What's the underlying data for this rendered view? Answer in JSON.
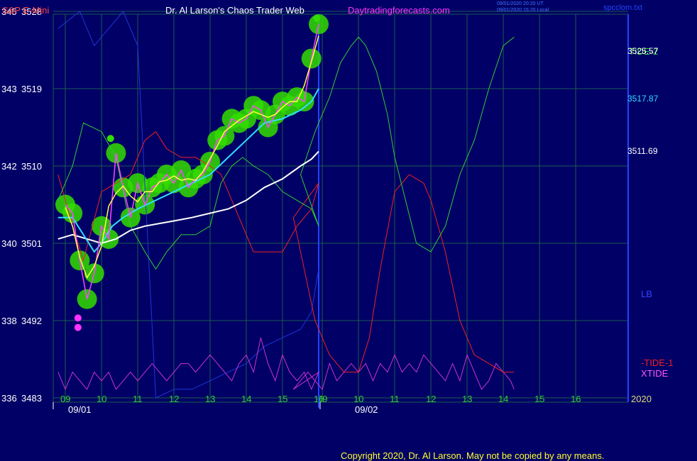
{
  "header": {
    "symbol": "S&P E-Mini",
    "title": "Dr. Al Larson's Chaos Trader Web",
    "site": "Daytradingforecasts.com",
    "stamp_utc": "09/01/2020 20:20 UT",
    "stamp_local": "09/01/2020 15:20 Local",
    "file": "spcclom.txt"
  },
  "right_labels": {
    "tide2": "TIDE-2",
    "tide1": "-TIDE-1",
    "xtide": "XTIDE",
    "lb": "LB",
    "year": "2020",
    "price_1": "3525.57",
    "price_2": "3517.87",
    "price_3": "3511.69"
  },
  "footer": {
    "copyright": "Copyright 2020, Dr. Al Larson. May not be copied by any means."
  },
  "colors": {
    "background": "#000066",
    "grid": "#1e5a4e",
    "price": "#ff44ff",
    "smooth": "#ffff44",
    "ma_cyan": "#33ddff",
    "ma_white": "#ffffff",
    "tide2": "#33cc33",
    "tide1": "#ee2222",
    "xtide": "#cc33cc",
    "lb": "#2233dd",
    "marker": "#33dd00",
    "divider": "#2244ff"
  },
  "chart_data": {
    "type": "line",
    "title": "S&P E-Mini",
    "y_left_outer": [
      "345",
      "343",
      "342",
      "340",
      "338",
      "336"
    ],
    "y_left_inner": [
      "3528",
      "3519",
      "3510",
      "3501",
      "3492",
      "3483"
    ],
    "ylim": [
      3483,
      3528
    ],
    "x_ticks_day1": [
      "09",
      "10",
      "11",
      "12",
      "13",
      "14",
      "15",
      "16"
    ],
    "x_ticks_day2": [
      "09",
      "10",
      "11",
      "12",
      "13",
      "14",
      "15",
      "16"
    ],
    "dates": [
      "09/01",
      "09/02"
    ],
    "series": [
      {
        "name": "S&P E-Mini",
        "x": [
          9.0,
          9.2,
          9.4,
          9.6,
          9.8,
          10.0,
          10.2,
          10.4,
          10.6,
          10.8,
          11.0,
          11.2,
          11.4,
          11.6,
          11.8,
          12.0,
          12.2,
          12.4,
          12.6,
          12.8,
          13.0,
          13.2,
          13.4,
          13.6,
          13.8,
          14.0,
          14.2,
          14.4,
          14.6,
          14.8,
          15.0,
          15.2,
          15.4,
          15.6,
          15.8,
          16.0
        ],
        "y": [
          3505.5,
          3504.5,
          3499,
          3494.5,
          3497.5,
          3503,
          3501.5,
          3511.5,
          3507.5,
          3504,
          3508,
          3505.5,
          3507.5,
          3508,
          3509,
          3508,
          3509.5,
          3507.5,
          3508.5,
          3509,
          3510.5,
          3513,
          3513.5,
          3515.5,
          3515,
          3515.5,
          3517,
          3516.5,
          3514.5,
          3516,
          3517.5,
          3517,
          3518,
          3517.5,
          3522.5,
          3526.5
        ]
      },
      {
        "name": "TIDE-2",
        "x": [
          8.8,
          9.2,
          9.5,
          10.0,
          10.4,
          10.8,
          11.2,
          11.5,
          11.8,
          12.2,
          12.6,
          13.0,
          13.3,
          13.6,
          13.9,
          14.2,
          14.6,
          15.0,
          15.4,
          15.8,
          16.0,
          16.4,
          16.8,
          17.2,
          17.5,
          17.8,
          18.0,
          18.2,
          18.5,
          18.8,
          19.0,
          19.3,
          19.6,
          20.0,
          20.4,
          20.8,
          21.2,
          21.6,
          22.0,
          22.3
        ],
        "y": [
          3506,
          3510,
          3515,
          3514,
          3511,
          3503,
          3500,
          3498,
          3500,
          3502,
          3502,
          3503,
          3508,
          3510,
          3511,
          3510,
          3509,
          3507,
          3506,
          3505,
          3503,
          3509,
          3514,
          3518,
          3522,
          3524,
          3525,
          3524,
          3521,
          3516,
          3511,
          3506,
          3501,
          3500,
          3503,
          3509,
          3513,
          3519,
          3524,
          3525
        ]
      },
      {
        "name": "-TIDE-1",
        "x": [
          8.8,
          9.2,
          9.5,
          10.0,
          10.4,
          10.8,
          11.2,
          11.5,
          11.8,
          12.2,
          12.6,
          13.0,
          13.3,
          13.6,
          13.9,
          14.2,
          14.6,
          15.0,
          15.4,
          15.8,
          16.0,
          16.2,
          16.5,
          16.8,
          17.2,
          17.6,
          18.0,
          18.3,
          18.6,
          19.0,
          19.4,
          19.8,
          20.0,
          20.4,
          20.8,
          21.2,
          21.6,
          22.0,
          22.3
        ],
        "y": [
          3509,
          3503,
          3499,
          3507,
          3508,
          3509,
          3513,
          3514,
          3512,
          3511,
          3511,
          3510,
          3509,
          3506,
          3503,
          3500,
          3500,
          3500,
          3503,
          3505,
          3508,
          3504,
          3498,
          3492,
          3488,
          3486,
          3486,
          3490,
          3498,
          3507,
          3509,
          3508,
          3506,
          3500,
          3492,
          3488,
          3487,
          3486,
          3486
        ]
      },
      {
        "name": "XTIDE",
        "x": [
          8.8,
          9.0,
          9.2,
          9.4,
          9.6,
          9.8,
          10.0,
          10.2,
          10.4,
          10.6,
          10.8,
          11.0,
          11.2,
          11.4,
          11.6,
          11.8,
          12.0,
          12.2,
          12.4,
          12.6,
          12.8,
          13.0,
          13.2,
          13.4,
          13.6,
          13.8,
          14.0,
          14.2,
          14.4,
          14.6,
          14.8,
          15.0,
          15.2,
          15.4,
          15.6,
          15.8,
          16.0,
          16.2,
          16.4,
          16.6,
          16.8,
          17.0,
          17.2,
          17.4,
          17.6,
          17.8,
          18.0,
          18.2,
          18.4,
          18.6,
          18.8,
          19.0,
          19.2,
          19.4,
          19.6,
          19.8,
          20.0,
          20.2,
          20.4,
          20.6,
          20.8,
          21.0,
          21.2,
          21.4,
          21.6,
          21.8,
          22.0,
          22.2,
          22.3
        ],
        "y": [
          3486,
          3484,
          3486,
          3485,
          3484,
          3486,
          3485,
          3486,
          3484,
          3485,
          3486,
          3485,
          3486,
          3487,
          3486,
          3485,
          3486,
          3487,
          3487,
          3486,
          3487,
          3488,
          3487,
          3486,
          3485,
          3487,
          3488,
          3486,
          3490,
          3487,
          3485,
          3488,
          3486,
          3485,
          3486,
          3484,
          3486,
          3484,
          3485,
          3486,
          3485,
          3484,
          3487,
          3485,
          3486,
          3487,
          3486,
          3487,
          3485,
          3487,
          3486,
          3488,
          3486,
          3487,
          3486,
          3488,
          3487,
          3486,
          3485,
          3487,
          3485,
          3488,
          3486,
          3484,
          3485,
          3487,
          3486,
          3485,
          3484
        ]
      },
      {
        "name": "LB",
        "x": [
          8.8,
          9.4,
          9.8,
          10.2,
          10.6,
          11.0,
          11.5,
          12.0,
          12.5,
          13.0,
          13.5,
          14.0,
          14.5,
          15.0,
          15.5,
          15.8,
          16.0
        ],
        "y": [
          3526,
          3528,
          3524,
          3526,
          3528,
          3524,
          3483,
          3484,
          3484,
          3485,
          3486,
          3487,
          3489,
          3490,
          3491,
          3493,
          3498
        ]
      },
      {
        "name": "Cyan MA",
        "x": [
          8.8,
          9.2,
          9.5,
          9.8,
          10.0,
          10.3,
          10.6,
          11.0,
          11.5,
          12.0,
          12.5,
          13.0,
          13.5,
          14.0,
          14.5,
          15.0,
          15.5,
          15.8,
          16.0
        ],
        "y": [
          3504,
          3504,
          3502,
          3500,
          3501,
          3503,
          3504,
          3505,
          3506,
          3507,
          3508,
          3509,
          3511,
          3513,
          3515,
          3515.5,
          3516.5,
          3517.5,
          3519
        ]
      },
      {
        "name": "White MA",
        "x": [
          8.8,
          9.2,
          9.6,
          10.0,
          10.4,
          10.8,
          11.2,
          11.6,
          12.0,
          12.5,
          13.0,
          13.5,
          14.0,
          14.5,
          15.0,
          15.5,
          15.8,
          16.0
        ],
        "y": [
          3501.5,
          3502,
          3501.5,
          3501,
          3501.5,
          3502.5,
          3503,
          3503.3,
          3503.6,
          3504,
          3504.5,
          3505,
          3506,
          3507.5,
          3508.5,
          3510,
          3510.8,
          3511.7
        ]
      }
    ],
    "grid": true,
    "legend": "right"
  }
}
